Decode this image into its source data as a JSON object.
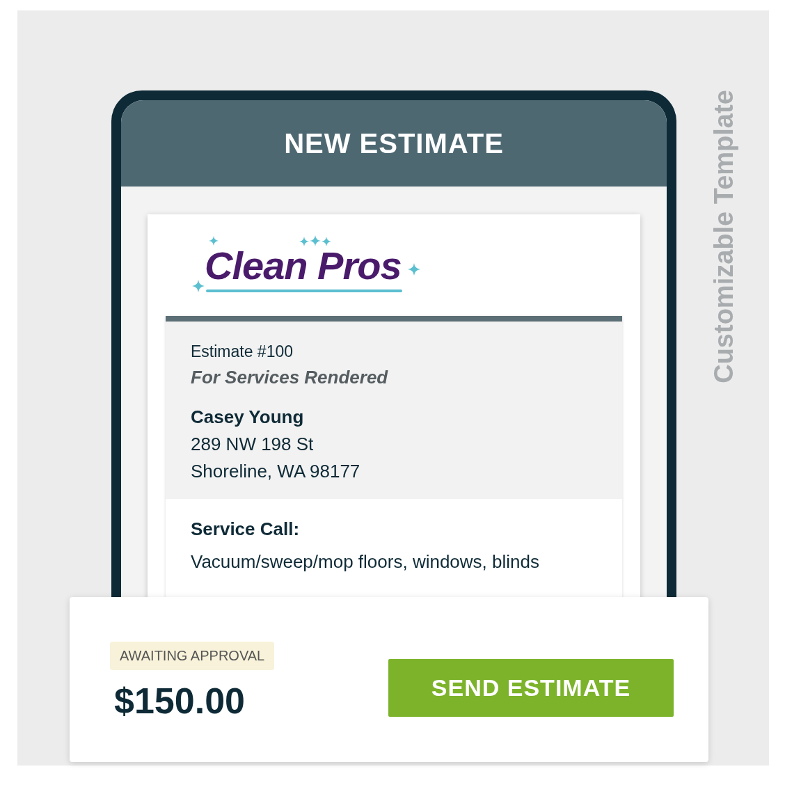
{
  "header": {
    "title": "NEW ESTIMATE"
  },
  "side_label": "Customizable Template",
  "logo": {
    "text": "Clean Pros"
  },
  "estimate": {
    "number": "Estimate #100",
    "subtitle": "For Services Rendered",
    "customer": {
      "name": "Casey Young",
      "address_line_1": "289 NW 198 St",
      "address_line_2": "Shoreline, WA 98177"
    },
    "service_label": "Service Call:",
    "service_description": "Vacuum/sweep/mop floors, windows, blinds"
  },
  "footer": {
    "status": "AWAITING APPROVAL",
    "total": "$150.00",
    "button": "SEND ESTIMATE"
  }
}
